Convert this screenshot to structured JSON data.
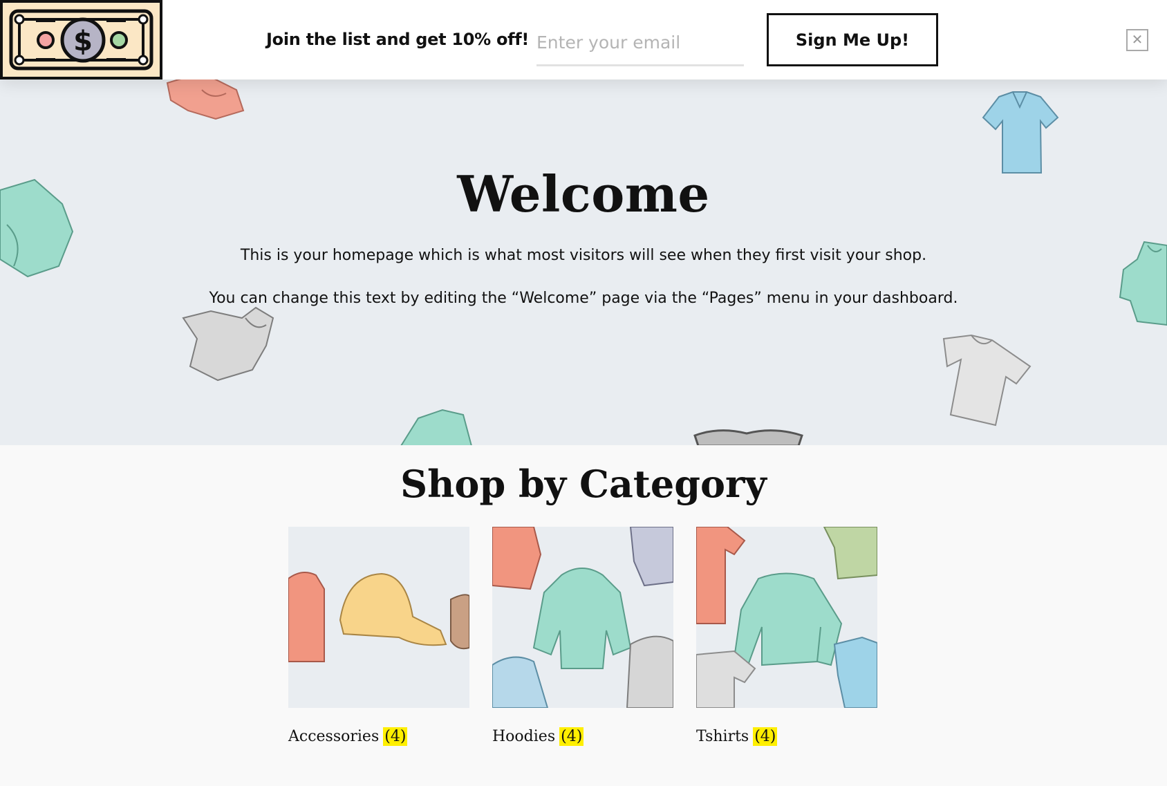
{
  "signup_bar": {
    "text": "Join the list and get 10% off!",
    "email_placeholder": "Enter your email",
    "button_label": "Sign Me Up!",
    "close_glyph": "✕",
    "logo_icon": "dollar-bill-icon"
  },
  "hero": {
    "title": "Welcome",
    "line1": "This is your homepage which is what most visitors will see when they first visit your shop.",
    "line2": "You can change this text by editing the “Welcome” page via the “Pages” menu in your dashboard."
  },
  "categories": {
    "heading": "Shop by Category",
    "items": [
      {
        "name": "Accessories",
        "count": "(4)"
      },
      {
        "name": "Hoodies",
        "count": "(4)"
      },
      {
        "name": "Tshirts",
        "count": "(4)"
      }
    ]
  },
  "colors": {
    "hero_bg": "#e9edf1",
    "count_highlight": "#ffef00",
    "page_bg": "#f9f9f9"
  }
}
